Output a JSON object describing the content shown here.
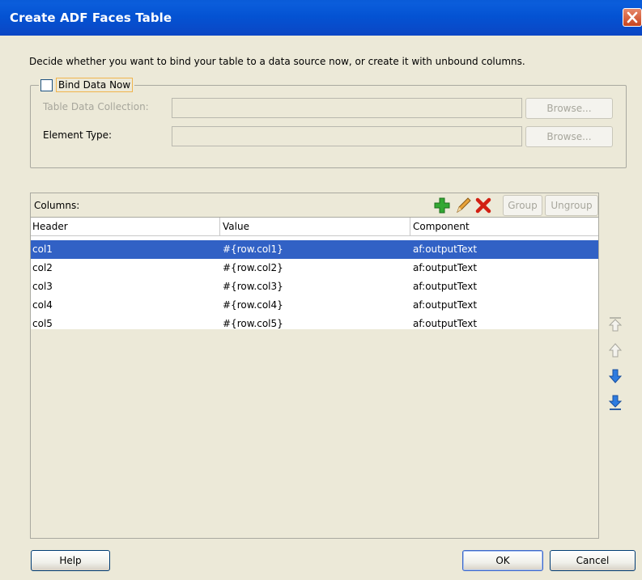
{
  "window": {
    "title": "Create ADF Faces Table"
  },
  "description": "Decide whether you want to bind your table to a data source now, or create it with unbound columns.",
  "bind": {
    "checkbox_label": "Bind Data Now",
    "checked": false,
    "table_data_collection_label": "Table Data Collection:",
    "table_data_collection_value": "",
    "element_type_label": "Element Type:",
    "element_type_value": "",
    "browse_label": "Browse..."
  },
  "columns": {
    "label": "Columns:",
    "group_label": "Group",
    "ungroup_label": "Ungroup",
    "headers": [
      "Header",
      "Value",
      "Component"
    ],
    "rows": [
      {
        "header": "col1",
        "value": "#{row.col1}",
        "component": "af:outputText",
        "selected": true
      },
      {
        "header": "col2",
        "value": "#{row.col2}",
        "component": "af:outputText",
        "selected": false
      },
      {
        "header": "col3",
        "value": "#{row.col3}",
        "component": "af:outputText",
        "selected": false
      },
      {
        "header": "col4",
        "value": "#{row.col4}",
        "component": "af:outputText",
        "selected": false
      },
      {
        "header": "col5",
        "value": "#{row.col5}",
        "component": "af:outputText",
        "selected": false
      }
    ]
  },
  "footer": {
    "help_label": "Help",
    "ok_label": "OK",
    "cancel_label": "Cancel"
  },
  "colors": {
    "title_bar": "#0453D3",
    "selection": "#3161C5",
    "dialog_bg": "#ECE9D8"
  },
  "icons": [
    "close-icon",
    "add-icon",
    "edit-icon",
    "delete-icon",
    "move-top-icon",
    "move-up-icon",
    "move-down-icon",
    "move-bottom-icon"
  ]
}
